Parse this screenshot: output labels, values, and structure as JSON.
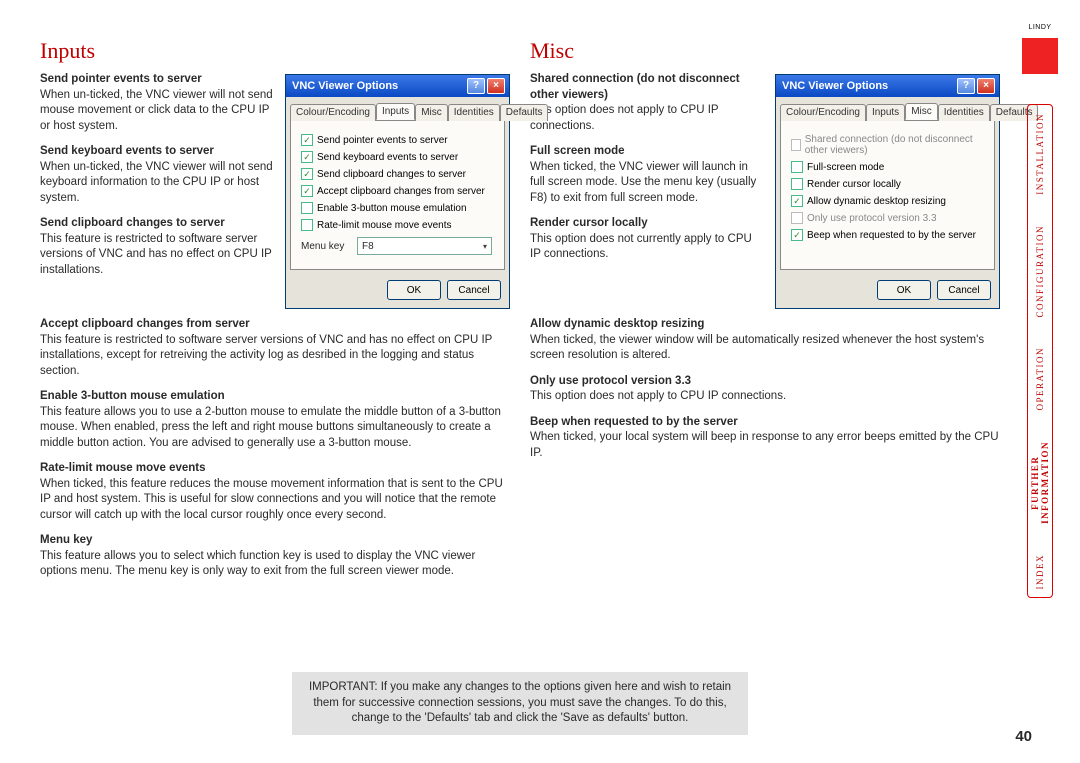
{
  "page_number": "40",
  "brand": "LINDY",
  "important": "IMPORTANT: If you make any changes to the options given here and wish to retain them for successive connection sessions, you must save the changes. To do this, change to the 'Defaults' tab and click the 'Save as defaults' button.",
  "sidebar": {
    "items": [
      "INSTALLATION",
      "CONFIGURATION",
      "OPERATION",
      "FURTHER\nINFORMATION",
      "INDEX"
    ],
    "active_index": 3
  },
  "left": {
    "title": "Inputs",
    "top": [
      {
        "h": "Send pointer events to server",
        "b": "When un-ticked, the VNC viewer will not send mouse movement or click data to the CPU IP or host system."
      },
      {
        "h": "Send keyboard events to server",
        "b": "When un-ticked, the VNC viewer will not send keyboard information to the CPU IP or host system."
      },
      {
        "h": "Send clipboard changes to server",
        "b": "This feature is restricted to software server versions of VNC and has no effect on CPU IP installations."
      }
    ],
    "bottom": [
      {
        "h": "Accept clipboard changes from server",
        "b": "This feature is restricted to software server versions of VNC and has no effect on CPU IP installations, except for retreiving the activity log as desribed in the logging and status section."
      },
      {
        "h": "Enable 3-button mouse emulation",
        "b": "This feature allows you to use a 2-button mouse to emulate the middle button of a 3-button mouse. When enabled, press the left and right mouse buttons simultaneously to create a middle button action. You are advised to generally use a 3-button mouse."
      },
      {
        "h": "Rate-limit mouse move events",
        "b": "When ticked, this feature reduces the mouse movement information that is sent to the CPU IP and host system. This is useful for slow connections and you will notice that the remote cursor will catch up with the local cursor roughly once every second."
      },
      {
        "h": "Menu key",
        "b": "This feature allows you to select which function key is used to display the VNC viewer options menu. The menu key is only way to exit from the full screen viewer mode."
      }
    ],
    "dialog": {
      "title": "VNC Viewer Options",
      "tabs": [
        "Colour/Encoding",
        "Inputs",
        "Misc",
        "Identities",
        "Defaults"
      ],
      "active": 1,
      "checkboxes": [
        {
          "label": "Send pointer events to server",
          "checked": true
        },
        {
          "label": "Send keyboard events to server",
          "checked": true
        },
        {
          "label": "Send clipboard changes to server",
          "checked": true
        },
        {
          "label": "Accept clipboard changes from server",
          "checked": true
        },
        {
          "label": "Enable 3-button mouse emulation",
          "checked": false
        },
        {
          "label": "Rate-limit mouse move events",
          "checked": false
        }
      ],
      "menu_label": "Menu key",
      "menu_value": "F8",
      "ok": "OK",
      "cancel": "Cancel"
    }
  },
  "right": {
    "title": "Misc",
    "top": [
      {
        "h": "Shared connection (do not disconnect other viewers)",
        "b": "This option does not apply to CPU IP connections."
      },
      {
        "h": "Full screen mode",
        "b": "When ticked, the VNC viewer will launch in full screen mode. Use the menu key (usually F8) to exit from full screen mode."
      },
      {
        "h": "Render cursor locally",
        "b": "This option does not currently apply to CPU IP connections."
      }
    ],
    "bottom": [
      {
        "h": "Allow dynamic desktop resizing",
        "b": "When ticked, the viewer window will be automatically resized whenever the host system's screen resolution is altered."
      },
      {
        "h": "Only use protocol version 3.3",
        "b": "This option does not apply to CPU IP connections."
      },
      {
        "h": "Beep when requested to by the server",
        "b": "When ticked, your local system will beep in response to any error beeps emitted by the CPU IP."
      }
    ],
    "dialog": {
      "title": "VNC Viewer Options",
      "tabs": [
        "Colour/Encoding",
        "Inputs",
        "Misc",
        "Identities",
        "Defaults"
      ],
      "active": 2,
      "checkboxes": [
        {
          "label": "Shared connection (do not disconnect other viewers)",
          "checked": false,
          "disabled": true
        },
        {
          "label": "Full-screen mode",
          "checked": false
        },
        {
          "label": "Render cursor locally",
          "checked": false
        },
        {
          "label": "Allow dynamic desktop resizing",
          "checked": true
        },
        {
          "label": "Only use protocol version 3.3",
          "checked": false,
          "disabled": true
        },
        {
          "label": "Beep when requested to by the server",
          "checked": true
        }
      ],
      "ok": "OK",
      "cancel": "Cancel"
    }
  }
}
